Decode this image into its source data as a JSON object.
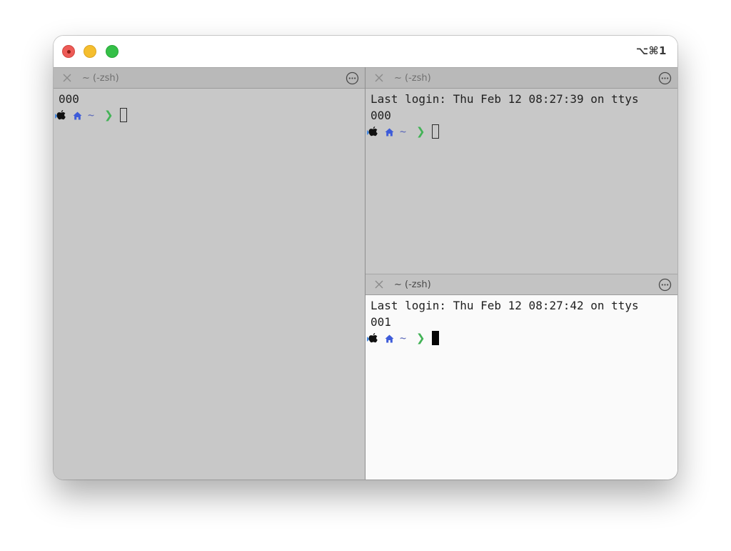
{
  "window": {
    "shortcut": "⌥⌘1"
  },
  "panes": {
    "left": {
      "tab_title": "~ (-zsh)",
      "lines": [
        "000"
      ],
      "prompt": {
        "path": "~",
        "arrow": "❯"
      }
    },
    "top_right": {
      "tab_title": "~ (-zsh)",
      "lines": [
        "Last login: Thu Feb 12 08:27:39 on ttys",
        "000"
      ],
      "prompt": {
        "path": "~",
        "arrow": "❯"
      }
    },
    "bottom_right": {
      "tab_title": "~ (-zsh)",
      "lines": [
        "Last login: Thu Feb 12 08:27:42 on ttys",
        "001"
      ],
      "prompt": {
        "path": "~",
        "arrow": "❯"
      }
    }
  },
  "colors": {
    "close": "#ed5b57",
    "minimize": "#f5be2e",
    "zoom": "#35c048",
    "inactive_pane": "#c8c8c8",
    "active_pane": "#fafafa",
    "prompt_home": "#3d5bd9",
    "prompt_tilde": "#5966b8",
    "prompt_arrow": "#43b357"
  },
  "icons": {
    "close": "close-icon",
    "more": "ellipsis-circle-icon",
    "apple": "apple-icon",
    "home": "home-icon"
  }
}
